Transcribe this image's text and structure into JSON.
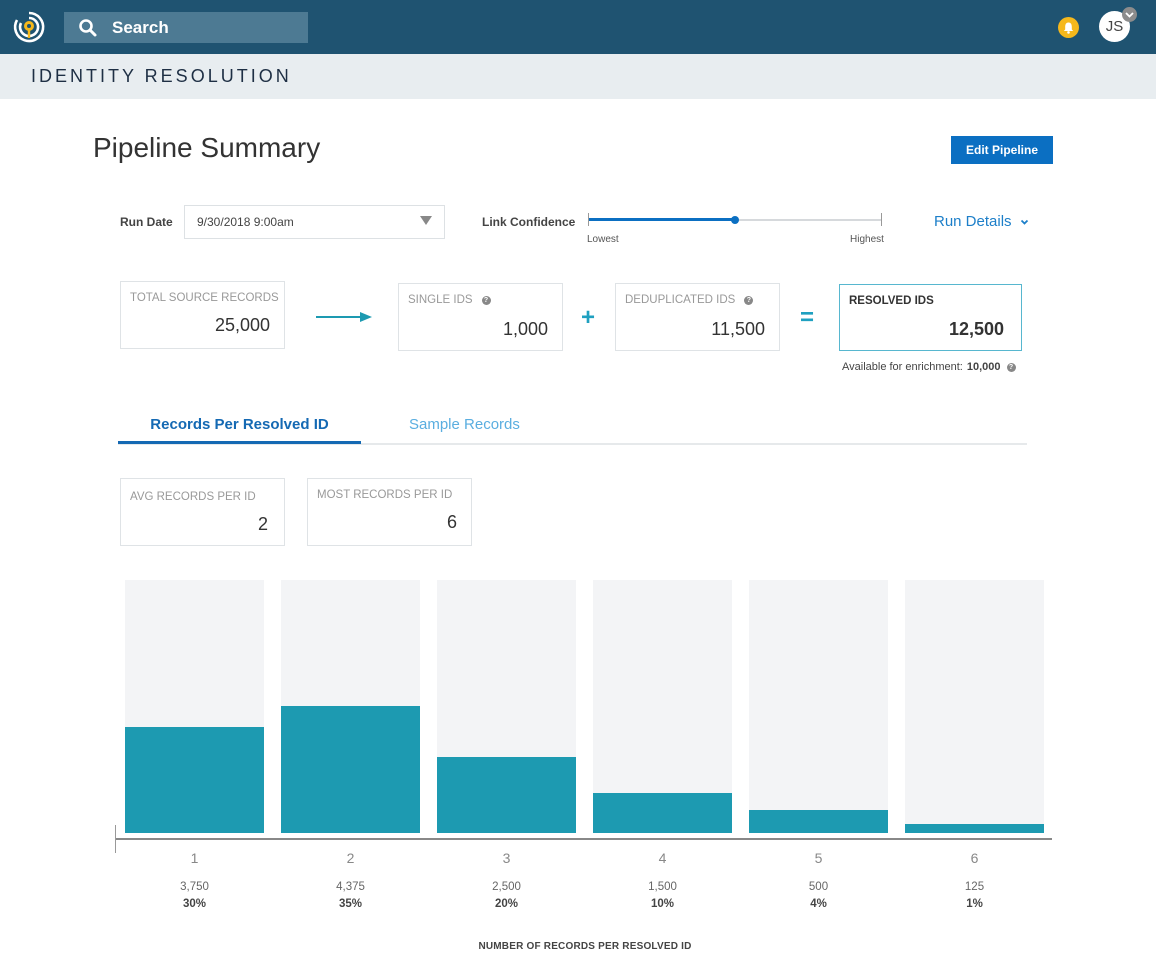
{
  "header": {
    "search_placeholder": "Search",
    "avatar_initials": "JS",
    "icons": [
      "app-logo-icon",
      "search-icon",
      "bell-icon",
      "chevron-down-icon"
    ]
  },
  "subheader": {
    "title": "IDENTITY RESOLUTION"
  },
  "page": {
    "title": "Pipeline Summary",
    "edit_button": "Edit Pipeline"
  },
  "filters": {
    "run_date_label": "Run Date",
    "run_date_value": "9/30/2018 9:00am",
    "link_confidence_label": "Link Confidence",
    "link_confidence_value_fraction": 0.5,
    "slider_low": "Lowest",
    "slider_high": "Highest",
    "run_details": "Run Details"
  },
  "stats": {
    "total_source": {
      "label": "TOTAL SOURCE RECORDS",
      "value": "25,000"
    },
    "single_ids": {
      "label": "SINGLE IDS",
      "value": "1,000"
    },
    "dedup_ids": {
      "label": "DEDUPLICATED IDS",
      "value": "11,500"
    },
    "resolved_ids": {
      "label": "RESOLVED IDS",
      "value": "12,500"
    },
    "plus": "+",
    "equals": "=",
    "enrichment_label": "Available for enrichment:",
    "enrichment_value": "10,000"
  },
  "tabs": [
    {
      "label": "Records Per Resolved ID",
      "active": true
    },
    {
      "label": "Sample Records",
      "active": false
    }
  ],
  "summary": {
    "avg": {
      "label": "AVG RECORDS PER ID",
      "value": "2"
    },
    "most": {
      "label": "MOST RECORDS PER ID",
      "value": "6"
    }
  },
  "chart_data": {
    "type": "bar",
    "title": "",
    "xlabel": "NUMBER OF RECORDS PER RESOLVED ID",
    "ylabel": "",
    "categories": [
      "1",
      "2",
      "3",
      "4",
      "5",
      "6"
    ],
    "values": [
      3750,
      4375,
      2500,
      1500,
      500,
      125
    ],
    "value_labels": [
      "3,750",
      "4,375",
      "2,500",
      "1,500",
      "500",
      "125"
    ],
    "percent_labels": [
      "30%",
      "35%",
      "20%",
      "10%",
      "4%",
      "1%"
    ],
    "fill_fractions": [
      0.42,
      0.5,
      0.3,
      0.16,
      0.09,
      0.035
    ],
    "grid": false,
    "colors": {
      "bar": "#1d9ab1",
      "track": "#f3f4f6"
    }
  }
}
